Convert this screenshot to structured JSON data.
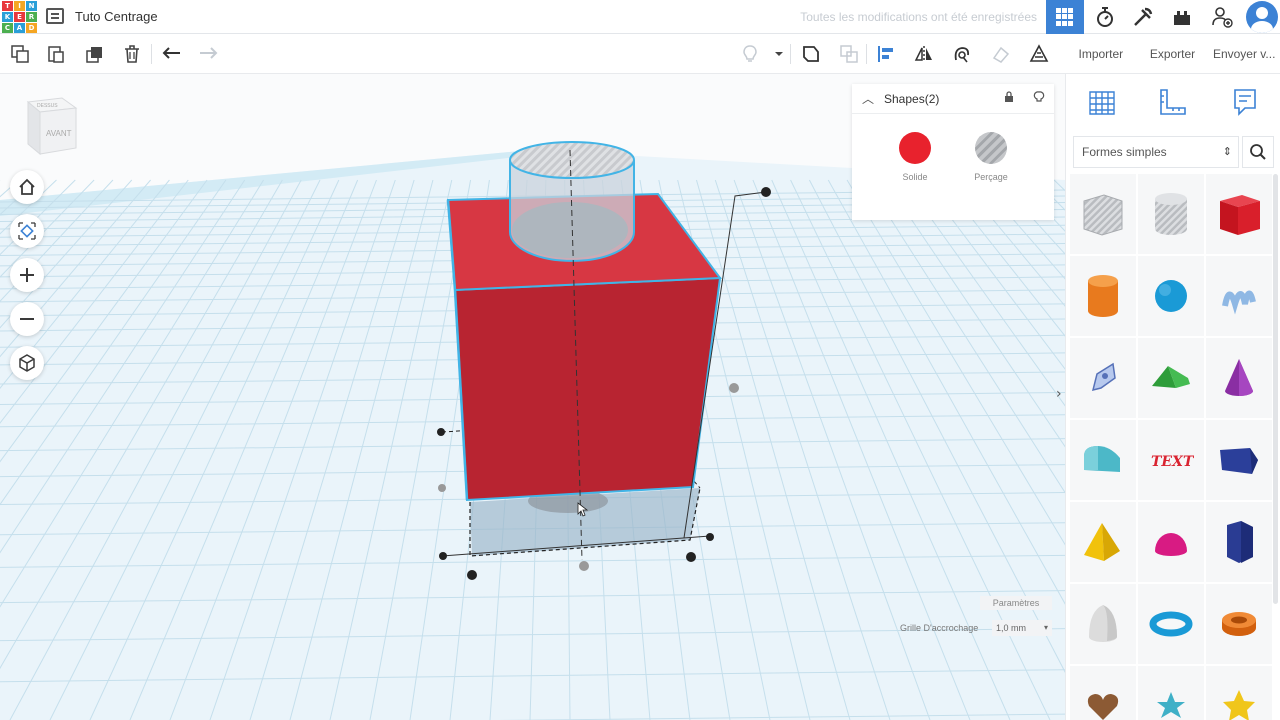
{
  "app": {
    "logo_letters": [
      "TIN",
      "KER",
      "CAD"
    ],
    "design_title": "Tuto Centrage",
    "save_status": "Toutes les modifications ont été enregistrées"
  },
  "topbar_buttons": [
    {
      "name": "grid-view-icon",
      "active": true
    },
    {
      "name": "circuits-icon",
      "active": false
    },
    {
      "name": "codeblocks-icon",
      "active": false
    },
    {
      "name": "lessons-icon",
      "active": false
    },
    {
      "name": "add-user-icon",
      "active": false
    }
  ],
  "right_header": {
    "import_label": "Importer",
    "export_label": "Exporter",
    "send_label": "Envoyer v..."
  },
  "viewcube": {
    "top_label": "DESSUS",
    "front_label": "AVANT"
  },
  "inspector": {
    "title": "Shapes(2)",
    "solid_label": "Solide",
    "hole_label": "Perçage",
    "solid_color": "#e8222d"
  },
  "library": {
    "category": "Formes simples",
    "tabs": [
      "workplane-icon",
      "ruler-icon",
      "notes-icon"
    ],
    "shapes": [
      "box-hole",
      "cylinder-hole",
      "box",
      "cylinder",
      "sphere",
      "scribble",
      "shape-generator",
      "roof",
      "cone",
      "round-roof",
      "text",
      "wedge",
      "pyramid",
      "half-sphere",
      "polygon",
      "paraboloid",
      "torus",
      "tube",
      "heart",
      "star",
      "star-gold"
    ]
  },
  "workplane": {
    "params_label": "Paramètres",
    "snap_label": "Grille D'accrochage",
    "snap_value": "1,0 mm"
  }
}
